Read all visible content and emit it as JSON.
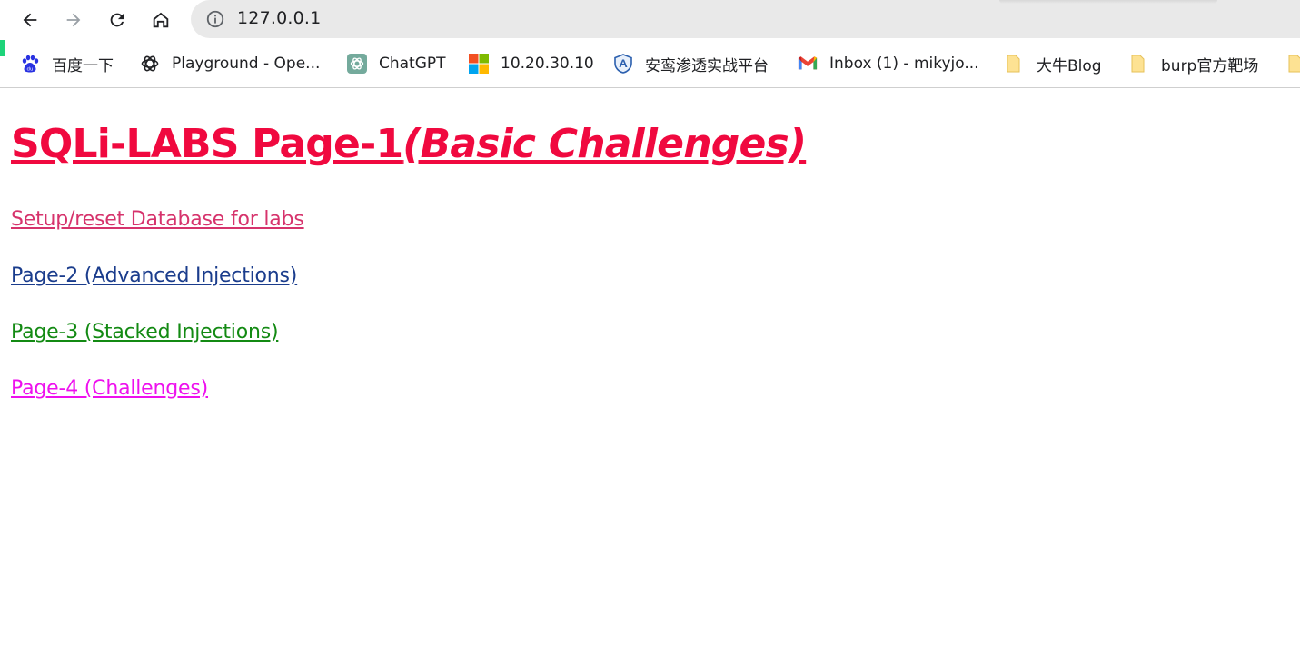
{
  "browser": {
    "url": "127.0.0.1",
    "nav_icons": [
      "back-arrow-icon",
      "forward-arrow-icon",
      "reload-icon",
      "home-icon"
    ],
    "info_icon": "info-circle-icon",
    "accent_color": "#1ed47a"
  },
  "bookmarks": [
    {
      "label": "百度一下",
      "icon": "baidu-paw-icon"
    },
    {
      "label": "Playground - Ope...",
      "icon": "openai-logo-icon"
    },
    {
      "label": "ChatGPT",
      "icon": "chatgpt-logo-icon"
    },
    {
      "label": "10.20.30.10",
      "icon": "windows-logo-icon"
    },
    {
      "label": "安鸾渗透实战平台",
      "icon": "shield-logo-icon"
    },
    {
      "label": "Inbox (1) - mikyjo...",
      "icon": "gmail-icon"
    },
    {
      "label": "大牛Blog",
      "icon": "folder-icon"
    },
    {
      "label": "burp官方靶场",
      "icon": "folder-icon"
    },
    {
      "label": "",
      "icon": "folder-icon"
    }
  ],
  "page": {
    "title_main": "SQLi-LABS Page-1",
    "title_sub": "(Basic Challenges)",
    "title_color": "#f0093f",
    "links": [
      {
        "label": "Setup/reset Database for labs",
        "color": "#d6336c"
      },
      {
        "label": "Page-2 (Advanced Injections)",
        "color": "#1a3c8c"
      },
      {
        "label": "Page-3 (Stacked Injections)",
        "color": "#138a13"
      },
      {
        "label": "Page-4 (Challenges)",
        "color": "#ee10ee"
      }
    ]
  }
}
